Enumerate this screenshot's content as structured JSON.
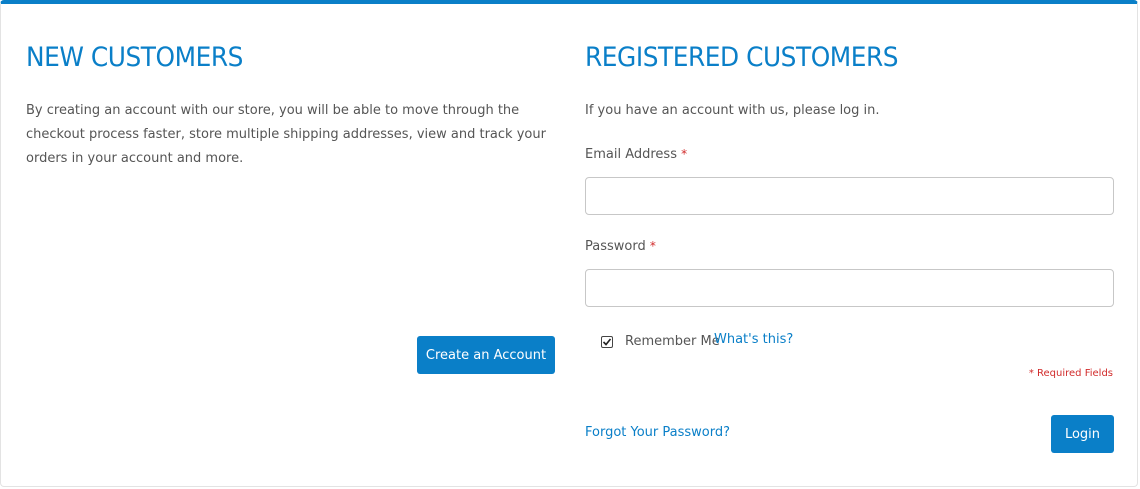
{
  "colors": {
    "accent": "#0a7fc8",
    "required": "#d12b2b",
    "text": "#555555"
  },
  "new_customers": {
    "heading": "NEW CUSTOMERS",
    "description": "By creating an account with our store, you will be able to move through the checkout process faster, store multiple shipping addresses, view and track your orders in your account and more.",
    "create_button": "Create an Account"
  },
  "registered": {
    "heading": "REGISTERED CUSTOMERS",
    "intro": "If you have an account with us, please log in.",
    "email_label": "Email Address",
    "email_value": "",
    "password_label": "Password",
    "password_value": "",
    "required_marker": "*",
    "remember_label": "Remember Me",
    "remember_checked": true,
    "whats_this": "What's this?",
    "required_note": "* Required Fields",
    "forgot_link": "Forgot Your Password?",
    "login_button": "Login"
  }
}
